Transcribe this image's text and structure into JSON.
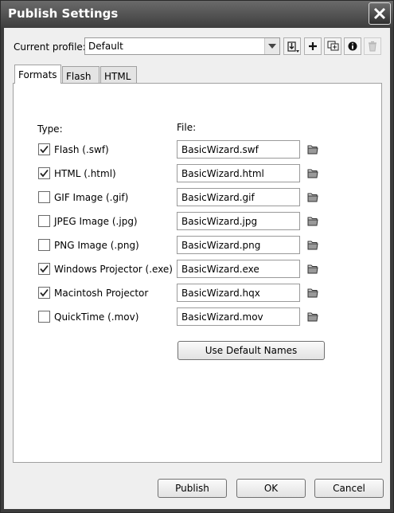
{
  "window": {
    "title": "Publish Settings"
  },
  "profile": {
    "label": "Current profile:",
    "value": "Default"
  },
  "toolbar_icons": [
    "import-export-icon",
    "add-icon",
    "duplicate-icon",
    "info-icon",
    "delete-icon"
  ],
  "tabs": [
    {
      "label": "Formats",
      "active": true
    },
    {
      "label": "Flash",
      "active": false
    },
    {
      "label": "HTML",
      "active": false
    }
  ],
  "headers": {
    "type": "Type:",
    "file": "File:"
  },
  "formats": [
    {
      "label": "Flash  (.swf)",
      "checked": true,
      "file": "BasicWizard.swf"
    },
    {
      "label": "HTML  (.html)",
      "checked": true,
      "file": "BasicWizard.html"
    },
    {
      "label": "GIF Image  (.gif)",
      "checked": false,
      "file": "BasicWizard.gif"
    },
    {
      "label": "JPEG Image  (.jpg)",
      "checked": false,
      "file": "BasicWizard.jpg"
    },
    {
      "label": "PNG Image  (.png)",
      "checked": false,
      "file": "BasicWizard.png"
    },
    {
      "label": "Windows Projector  (.exe)",
      "checked": true,
      "file": "BasicWizard.exe"
    },
    {
      "label": "Macintosh Projector",
      "checked": true,
      "file": "BasicWizard.hqx"
    },
    {
      "label": "QuickTime  (.mov)",
      "checked": false,
      "file": "BasicWizard.mov"
    }
  ],
  "buttons": {
    "use_default_names": "Use Default Names",
    "publish": "Publish",
    "ok": "OK",
    "cancel": "Cancel"
  }
}
